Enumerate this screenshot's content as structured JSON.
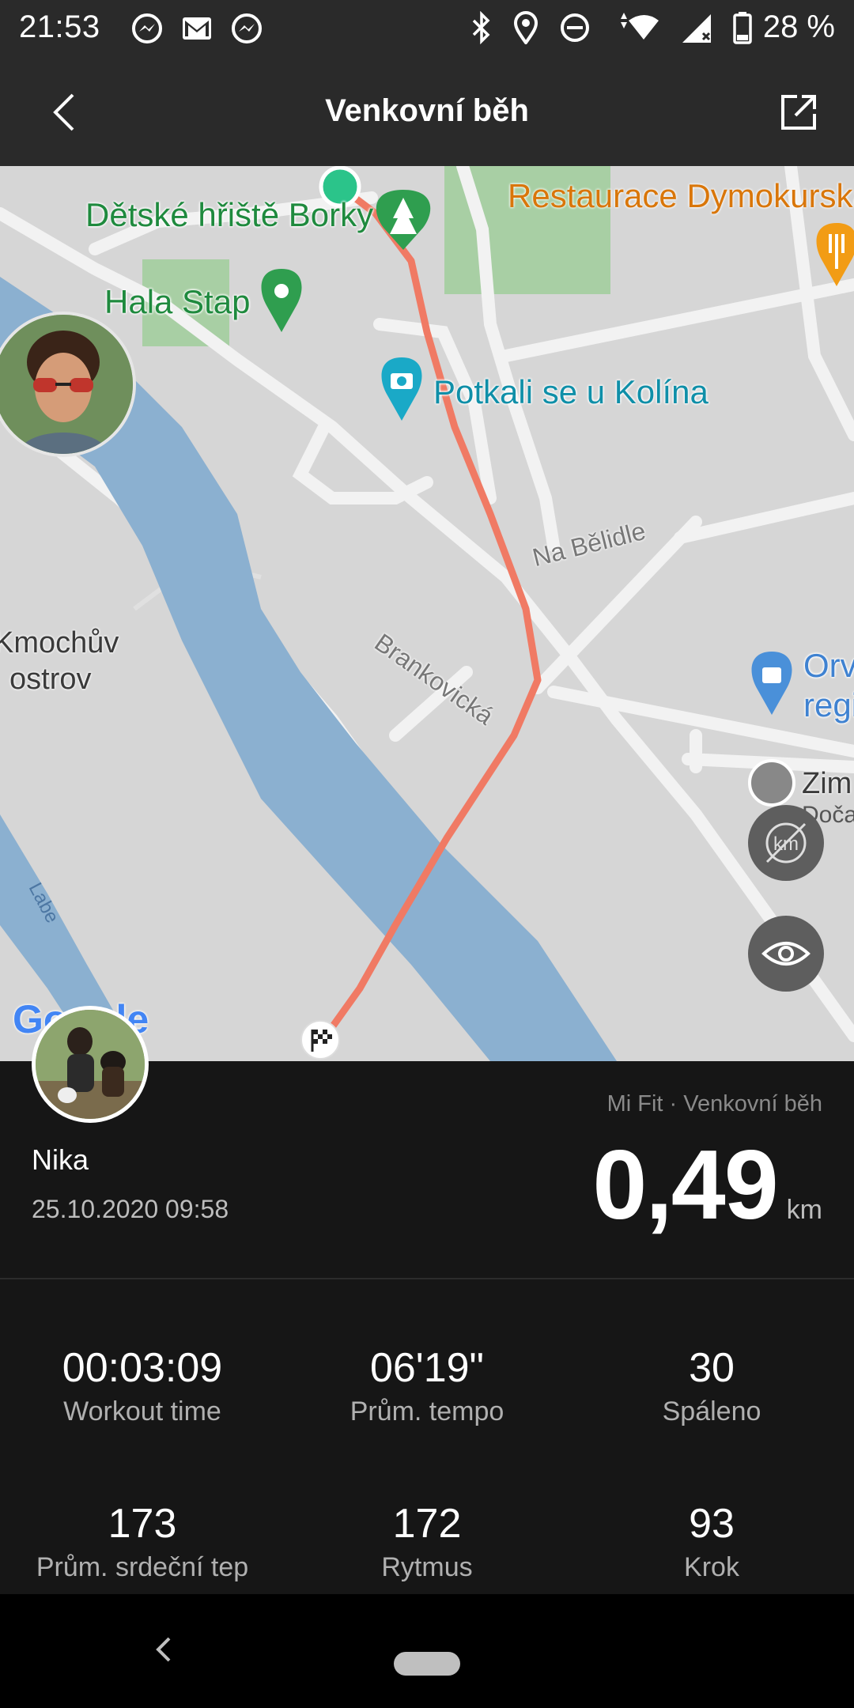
{
  "status_bar": {
    "time": "21:53",
    "battery": "28 %",
    "icons_left": [
      "messenger-icon",
      "gmail-icon",
      "messenger-icon"
    ],
    "icons_right": [
      "bluetooth-icon",
      "location-icon",
      "dnd-icon",
      "wifi-icon",
      "signal-icon",
      "battery-icon"
    ]
  },
  "app_bar": {
    "title": "Venkovní běh"
  },
  "map": {
    "poi": {
      "playground": "Dětské hřiště Borky",
      "hall": "Hala Stap",
      "restaurant": "Restaurace Dymokurska",
      "photo_spot": "Potkali se u Kolína",
      "shop_partial_1": "Orv",
      "shop_partial_2": "regi",
      "zim_partial": "Zim",
      "doca_partial": "Doča"
    },
    "streets": {
      "na_belidle": "Na Bělidle",
      "brankovicka": "Brankovická"
    },
    "areas": {
      "island_line1": "Kmochův",
      "island_line2": "ostrov"
    },
    "river": "Labe",
    "google_logo": "Google",
    "route_color": "#f07a64",
    "water_color": "#8bb0d0"
  },
  "summary": {
    "source": "Mi Fit · Venkovní běh",
    "user_name": "Nika",
    "datetime": "25.10.2020 09:58",
    "distance_value": "0,49",
    "distance_unit": "km"
  },
  "stats": [
    {
      "value": "00:03:09",
      "label": "Workout time"
    },
    {
      "value": "06'19\"",
      "label": "Prům. tempo"
    },
    {
      "value": "30",
      "label": "Spáleno"
    },
    {
      "value": "173",
      "label": "Prům. srdeční tep"
    },
    {
      "value": "172",
      "label": "Rytmus"
    },
    {
      "value": "93",
      "label": "Krok"
    }
  ]
}
